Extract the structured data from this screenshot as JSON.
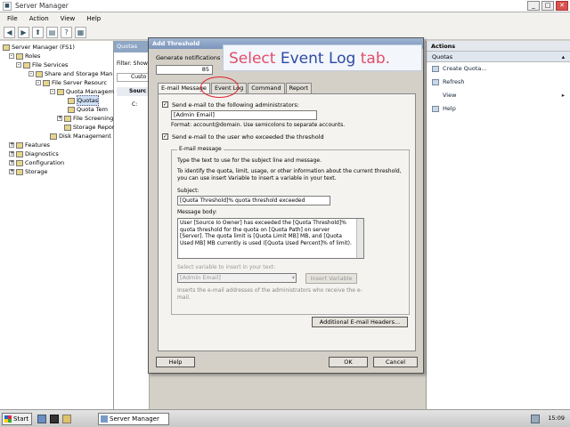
{
  "window": {
    "title": "Server Manager",
    "controls": [
      "_",
      "□",
      "✕"
    ]
  },
  "menu": [
    "File",
    "Action",
    "View",
    "Help"
  ],
  "tree": {
    "root": "Server Manager (FS1)",
    "roles": "Roles",
    "file_services": "File Services",
    "share_storage": "Share and Storage Man",
    "fsrm": "File Server Resourc",
    "quota_mgmt": "Quota Managem",
    "quotas": "Quotas",
    "quota_templates": "Quota Tem",
    "file_screening": "File Screening Ma",
    "storage_reports": "Storage Reports",
    "disk_mgmt": "Disk Management",
    "features": "Features",
    "diagnostics": "Diagnostics",
    "configuration": "Configuration",
    "storage": "Storage"
  },
  "middle": {
    "header": "Quotas",
    "filter": "Filter: Show",
    "col": "Custo",
    "row_source": "Sourc",
    "row_c": "C:"
  },
  "actions": {
    "header": "Actions",
    "sub": "Quotas",
    "items": [
      "Create Quota...",
      "Refresh",
      "View",
      "Help"
    ],
    "view_arrow": "▸"
  },
  "dialog": {
    "title": "Add Threshold",
    "generate_label": "Generate notifications w",
    "threshold_value": "85",
    "tabs": [
      "E-mail Message",
      "Event Log",
      "Command",
      "Report"
    ],
    "send_admin_label": "Send e-mail to the following administrators:",
    "admin_value": "[Admin Email]",
    "format_hint": "Format: account@domain. Use semicolons to separate accounts.",
    "send_user_label": "Send e-mail to the user who exceeded the threshold",
    "email_group_label": "E-mail message",
    "type_text_label": "Type the text to use for the subject line and message.",
    "identify_help": "To identify the quota, limit, usage, or other information about the current threshold, you can use insert Variable to insert a variable in your text.",
    "subject_label": "Subject:",
    "subject_value": "[Quota Threshold]% quota threshold exceeded",
    "message_body_label": "Message body:",
    "message_body_value": "User [Source Io Owner] has exceeded the [Quota Threshold]% quota threshold for the quota on [Quota Path] on server [Server]. The quota limit is [Quota Limit MB] MB, and [Quota Used MB] MB currently is used ([Quota Used Percent]% of limit).",
    "variable_label": "Select variable to insert in your text:",
    "variable_value": "[Admin Email]",
    "insert_variable": "Insert Variable",
    "variable_desc": "Inserts the e-mail addresses of the administrators who receive the e-mail.",
    "additional_headers": "Additional E-mail Headers...",
    "help": "Help",
    "ok": "OK",
    "cancel": "Cancel"
  },
  "callout": {
    "word1": "Select",
    "word2": "Event Log",
    "word3": "tab."
  },
  "taskbar": {
    "start": "Start",
    "item": "Server Manager",
    "clock": "15:09"
  }
}
